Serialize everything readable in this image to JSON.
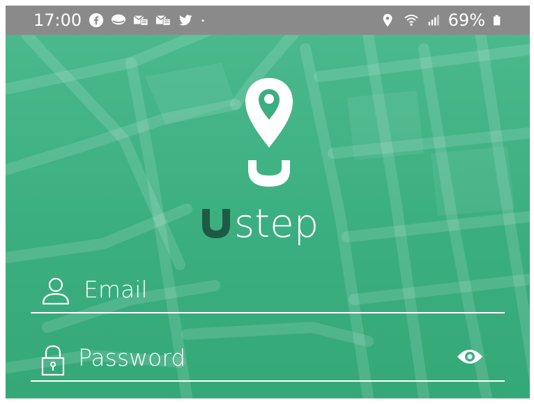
{
  "status_bar": {
    "time": "17:00",
    "battery": "69%",
    "left_icons": [
      "facebook-icon",
      "chat-bubble-icon",
      "mail-icon",
      "mail-icon",
      "twitter-icon",
      "dot-icon"
    ],
    "right_icons": [
      "location-pin-icon",
      "wifi-icon",
      "signal-icon",
      "battery-icon"
    ]
  },
  "brand": {
    "name": "step"
  },
  "form": {
    "email_label": "Email",
    "password_label": "Password"
  },
  "colors": {
    "primary": "#3dae82",
    "brand_dark": "#1e5a44",
    "status_bar": "#8a8a8a",
    "text": "#ffffff"
  }
}
